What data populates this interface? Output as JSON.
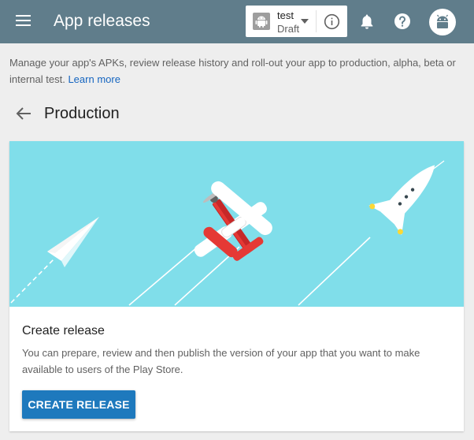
{
  "topbar": {
    "title": "App releases",
    "app_name": "test",
    "app_status": "Draft",
    "menu_icon": "hamburger-menu-icon",
    "info_icon": "info-icon",
    "notifications_icon": "bell-icon",
    "help_icon": "help-icon",
    "avatar_icon": "android-avatar-icon",
    "background_color": "#607d8b"
  },
  "intro": {
    "text": "Manage your app's APKs, review release history and roll-out your app to production, alpha, beta or internal test.",
    "link": "Learn more",
    "link_color": "#1565c0"
  },
  "page": {
    "back_icon": "arrow-back-icon",
    "title": "Production"
  },
  "card": {
    "illustration": "paper-plane-biplane-rocket-illustration",
    "hero_color": "#80deea",
    "title": "Create release",
    "description": "You can prepare, review and then publish the version of your app that you want to make available to users of the Play Store.",
    "button_label": "CREATE RELEASE",
    "button_color": "#1e79bd"
  }
}
